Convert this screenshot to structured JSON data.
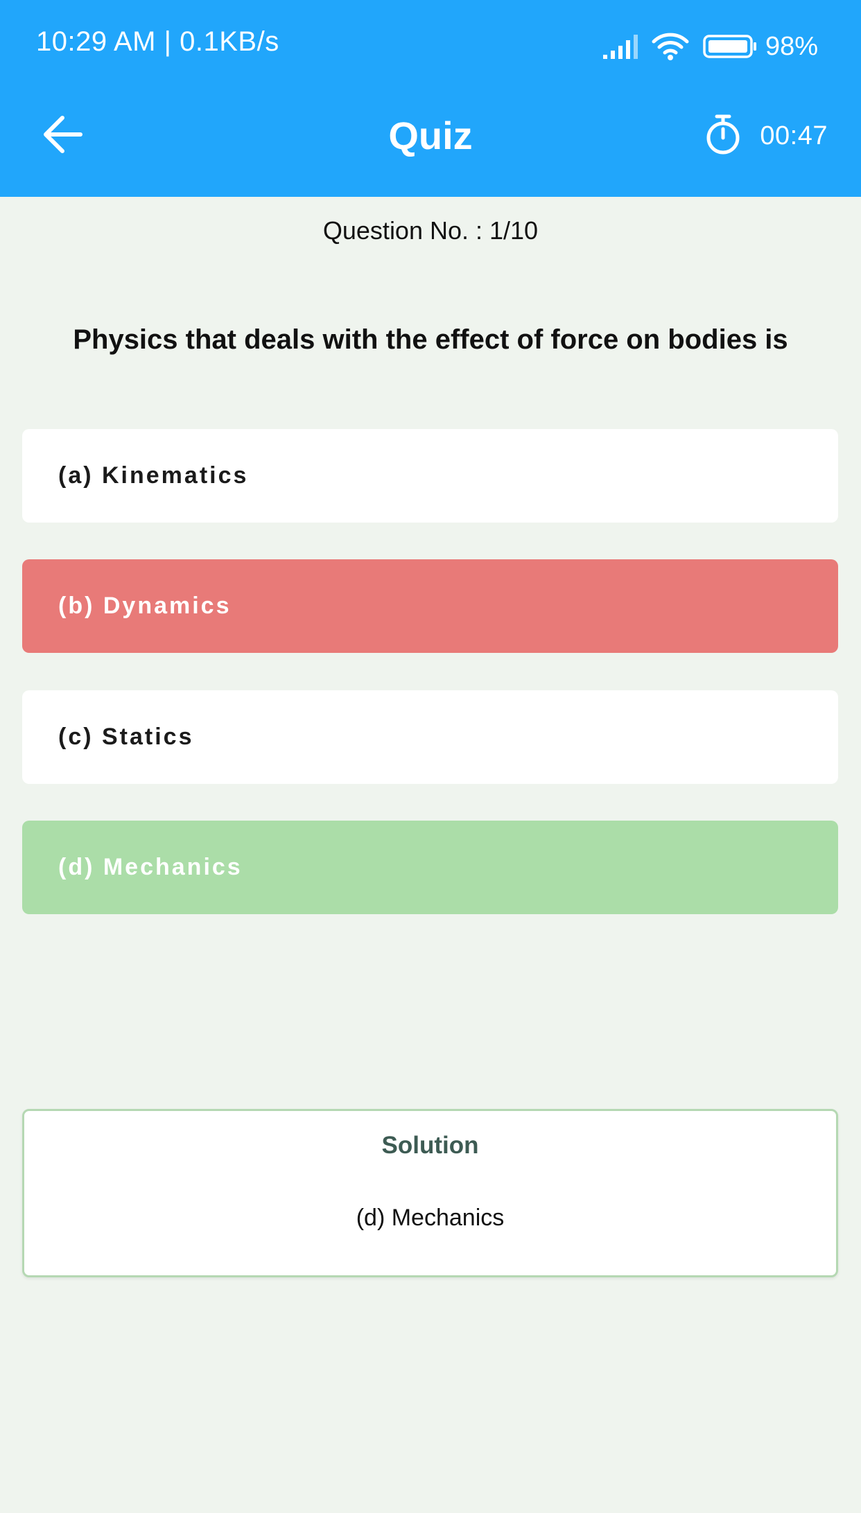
{
  "status_bar": {
    "time_speed": "10:29 AM | 0.1KB/s",
    "battery": "98%"
  },
  "header": {
    "title": "Quiz",
    "timer": "00:47"
  },
  "question_number": {
    "label": "Question No. :",
    "value": "1/10"
  },
  "question": {
    "text": "Physics that deals with the effect of force on bodies is"
  },
  "options": [
    {
      "label": "(a) Kinematics",
      "state": "default"
    },
    {
      "label": "(b) Dynamics",
      "state": "wrong"
    },
    {
      "label": "(c) Statics",
      "state": "default"
    },
    {
      "label": "(d) Mechanics",
      "state": "correct"
    }
  ],
  "solution": {
    "title": "Solution",
    "answer": "(d) Mechanics"
  },
  "colors": {
    "header": "#21a6fb",
    "background": "#eff4ee",
    "wrong": "#e87a78",
    "correct": "#abdda8",
    "solution_border": "#b5d8b3"
  },
  "icons": {
    "back": "arrow-left-icon",
    "signal": "signal-icon",
    "wifi": "wifi-icon",
    "battery": "battery-icon",
    "timer": "stopwatch-icon"
  }
}
